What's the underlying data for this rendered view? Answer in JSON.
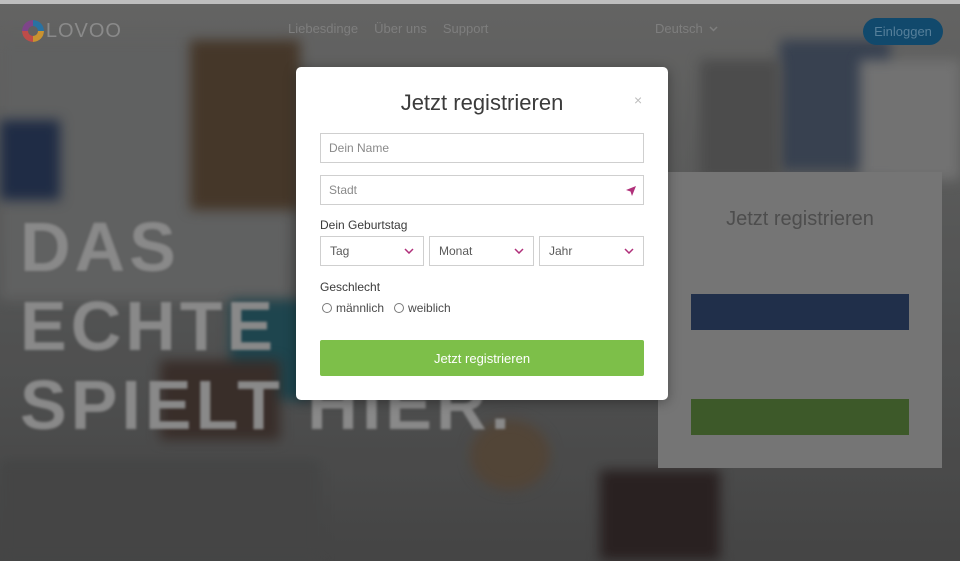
{
  "header": {
    "logo_text": "LOVOO",
    "nav": [
      "Liebesdinge",
      "Über uns",
      "Support"
    ],
    "language": "Deutsch",
    "login_label": "Einloggen"
  },
  "hero": {
    "line1": "DAS",
    "line2": "ECHTE L",
    "line3": "SPIELT HIER."
  },
  "modal": {
    "title": "Jetzt registrieren",
    "close_symbol": "×",
    "name_placeholder": "Dein Name",
    "city_placeholder": "Stadt",
    "birthday_label": "Dein Geburtstag",
    "birthday_selects": [
      "Tag",
      "Monat",
      "Jahr"
    ],
    "gender_label": "Geschlecht",
    "gender_options": [
      "männlich",
      "weiblich"
    ],
    "submit_label": "Jetzt registrieren"
  },
  "colors": {
    "accent_green": "#7dbf49",
    "icon_magenta": "#b0307a",
    "login_blue": "#0d4f78"
  }
}
